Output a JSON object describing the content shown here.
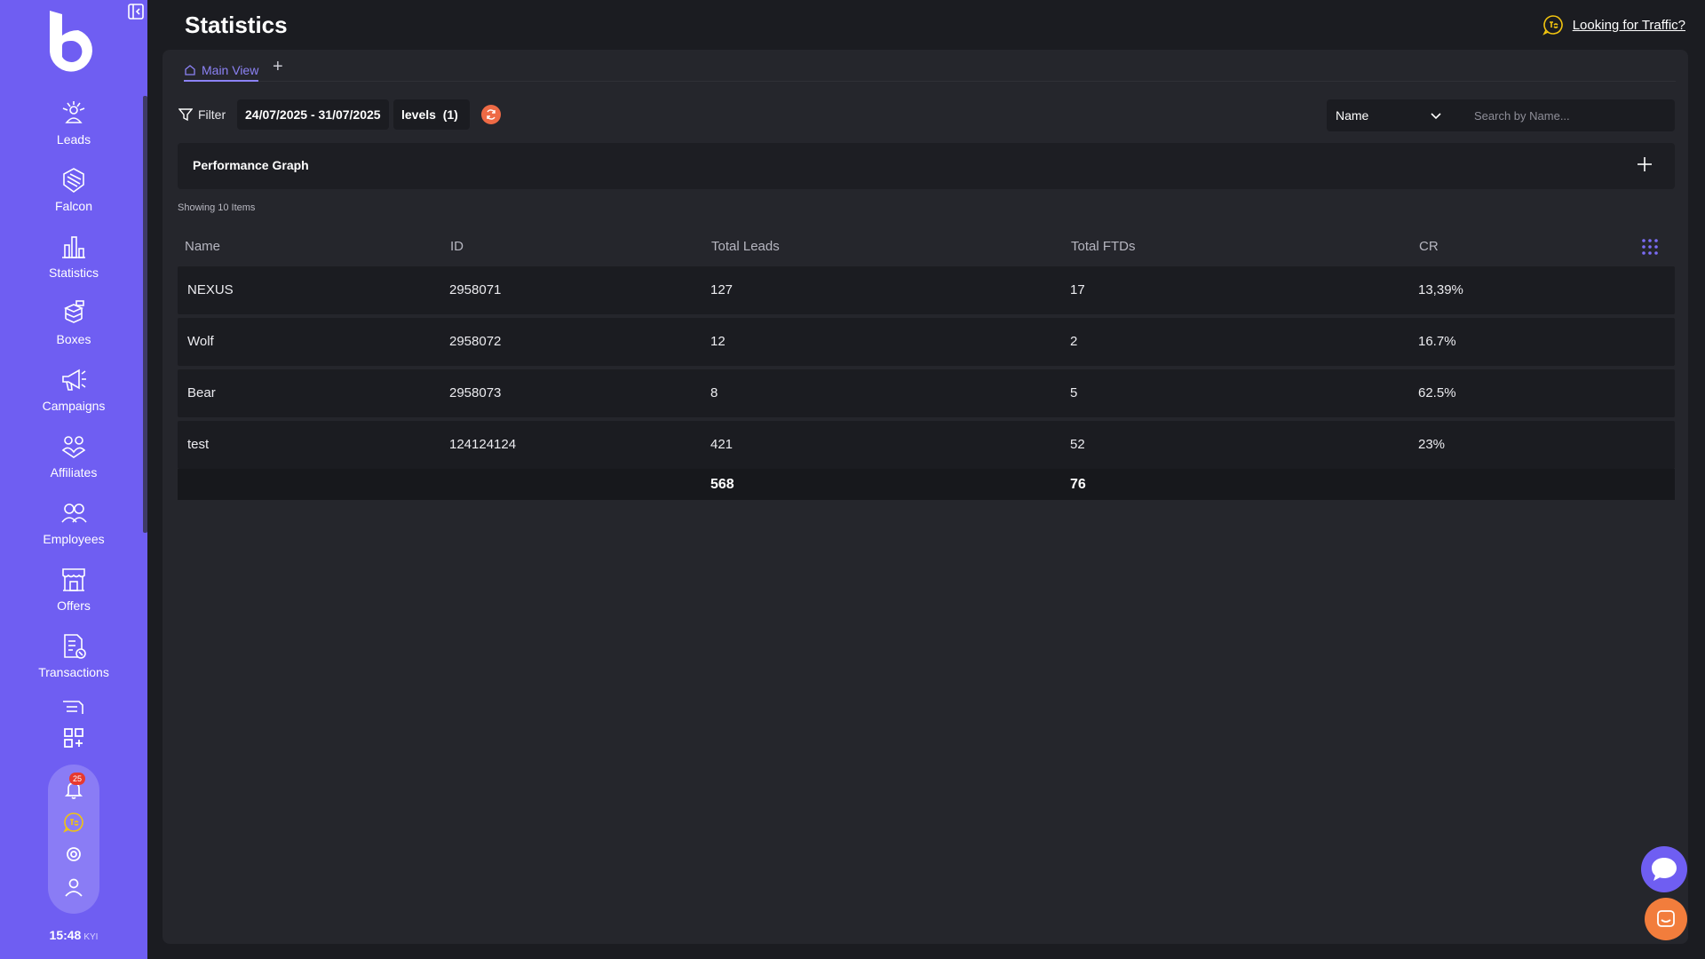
{
  "page": {
    "title": "Statistics"
  },
  "header": {
    "traffic_link": "Looking for Traffic?"
  },
  "sidebar": {
    "items": [
      {
        "label": "Leads",
        "icon": "leads-icon"
      },
      {
        "label": "Falcon",
        "icon": "falcon-icon"
      },
      {
        "label": "Statistics",
        "icon": "bar-chart-icon"
      },
      {
        "label": "Boxes",
        "icon": "boxes-icon"
      },
      {
        "label": "Campaigns",
        "icon": "megaphone-icon"
      },
      {
        "label": "Affiliates",
        "icon": "affiliates-icon"
      },
      {
        "label": "Employees",
        "icon": "employees-icon"
      },
      {
        "label": "Offers",
        "icon": "store-icon"
      },
      {
        "label": "Transactions",
        "icon": "transactions-icon"
      }
    ],
    "notifications_count": "25",
    "clock": {
      "time": "15:48",
      "zone": "KYI"
    }
  },
  "tabs": [
    {
      "label": "Main View"
    }
  ],
  "filters": {
    "filter_label": "Filter",
    "date_range": "24/07/2025 - 31/07/2025",
    "levels_label": "levels",
    "levels_count": "(1)"
  },
  "search": {
    "field": "Name",
    "placeholder": "Search by Name..."
  },
  "graph": {
    "title": "Performance Graph"
  },
  "table": {
    "showing": "Showing 10 Items",
    "columns": [
      "Name",
      "ID",
      "Total Leads",
      "Total FTDs",
      "CR"
    ],
    "rows": [
      {
        "name": "NEXUS",
        "id": "2958071",
        "leads": "127",
        "ftds": "17",
        "cr": "13,39%"
      },
      {
        "name": "Wolf",
        "id": "2958072",
        "leads": "12",
        "ftds": "2",
        "cr": "16.7%"
      },
      {
        "name": "Bear",
        "id": "2958073",
        "leads": "8",
        "ftds": "5",
        "cr": "62.5%"
      },
      {
        "name": "test",
        "id": "124124124",
        "leads": "421",
        "ftds": "52",
        "cr": "23%"
      }
    ],
    "totals": {
      "leads": "568",
      "ftds": "76"
    }
  },
  "colors": {
    "sidebar": "#6f5ef2",
    "accent": "#8c82f5",
    "refresh": "#ee6a45",
    "support": "#f27d3c",
    "badge": "#e8392f"
  }
}
